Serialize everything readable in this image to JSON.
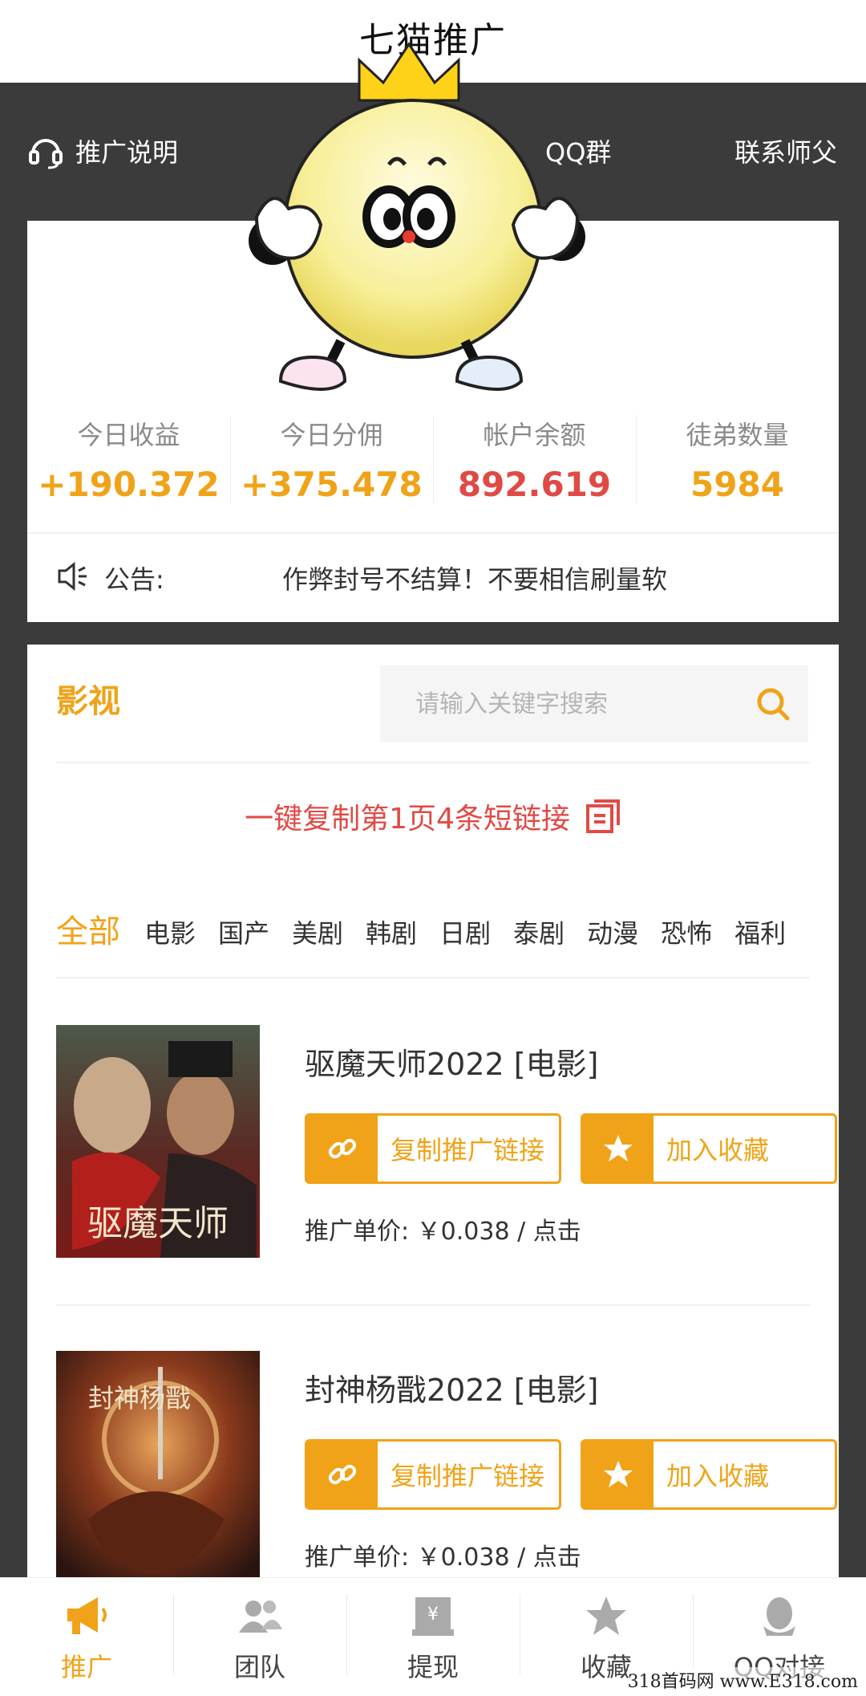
{
  "app": {
    "title": "七猫推广"
  },
  "topnav": {
    "guide": "推广说明",
    "qq_group": "QQ群",
    "contact": "联系师父"
  },
  "stats": [
    {
      "label": "今日收益",
      "value": "+190.372",
      "color": "#f0a318"
    },
    {
      "label": "今日分佣",
      "value": "+375.478",
      "color": "#f0a318"
    },
    {
      "label": "帐户余额",
      "value": "892.619",
      "color": "#e04a45"
    },
    {
      "label": "徒弟数量",
      "value": "5984",
      "color": "#f0a318"
    }
  ],
  "notice": {
    "label": "公告:",
    "text": "作弊封号不结算！不要相信刷量软"
  },
  "content": {
    "section_title": "影视",
    "search_placeholder": "请输入关键字搜索",
    "copy_all": "一键复制第1页4条短链接",
    "categories": [
      "全部",
      "电影",
      "国产",
      "美剧",
      "韩剧",
      "日剧",
      "泰剧",
      "动漫",
      "恐怖",
      "福利"
    ]
  },
  "movies": [
    {
      "title": "驱魔天师2022 [电影]",
      "poster_text": "驱魔天师",
      "copy_label": "复制推广链接",
      "fav_label": "加入收藏",
      "price": "推广单价: ￥0.038 / 点击"
    },
    {
      "title": "封神杨戬2022 [电影]",
      "poster_text": "封神杨戬",
      "copy_label": "复制推广链接",
      "fav_label": "加入收藏",
      "price": "推广单价: ￥0.038 / 点击"
    }
  ],
  "tabs": [
    {
      "label": "推广",
      "icon": "megaphone-icon",
      "active": true
    },
    {
      "label": "团队",
      "icon": "team-icon",
      "active": false
    },
    {
      "label": "提现",
      "icon": "withdraw-icon",
      "active": false
    },
    {
      "label": "收藏",
      "icon": "star-icon",
      "active": false
    },
    {
      "label": "QQ对接",
      "icon": "qq-icon",
      "active": false
    }
  ],
  "watermark": "318首码网 www.E318.com",
  "colors": {
    "accent": "#f0a318",
    "red": "#e04a45",
    "dark": "#3b3b3b"
  }
}
